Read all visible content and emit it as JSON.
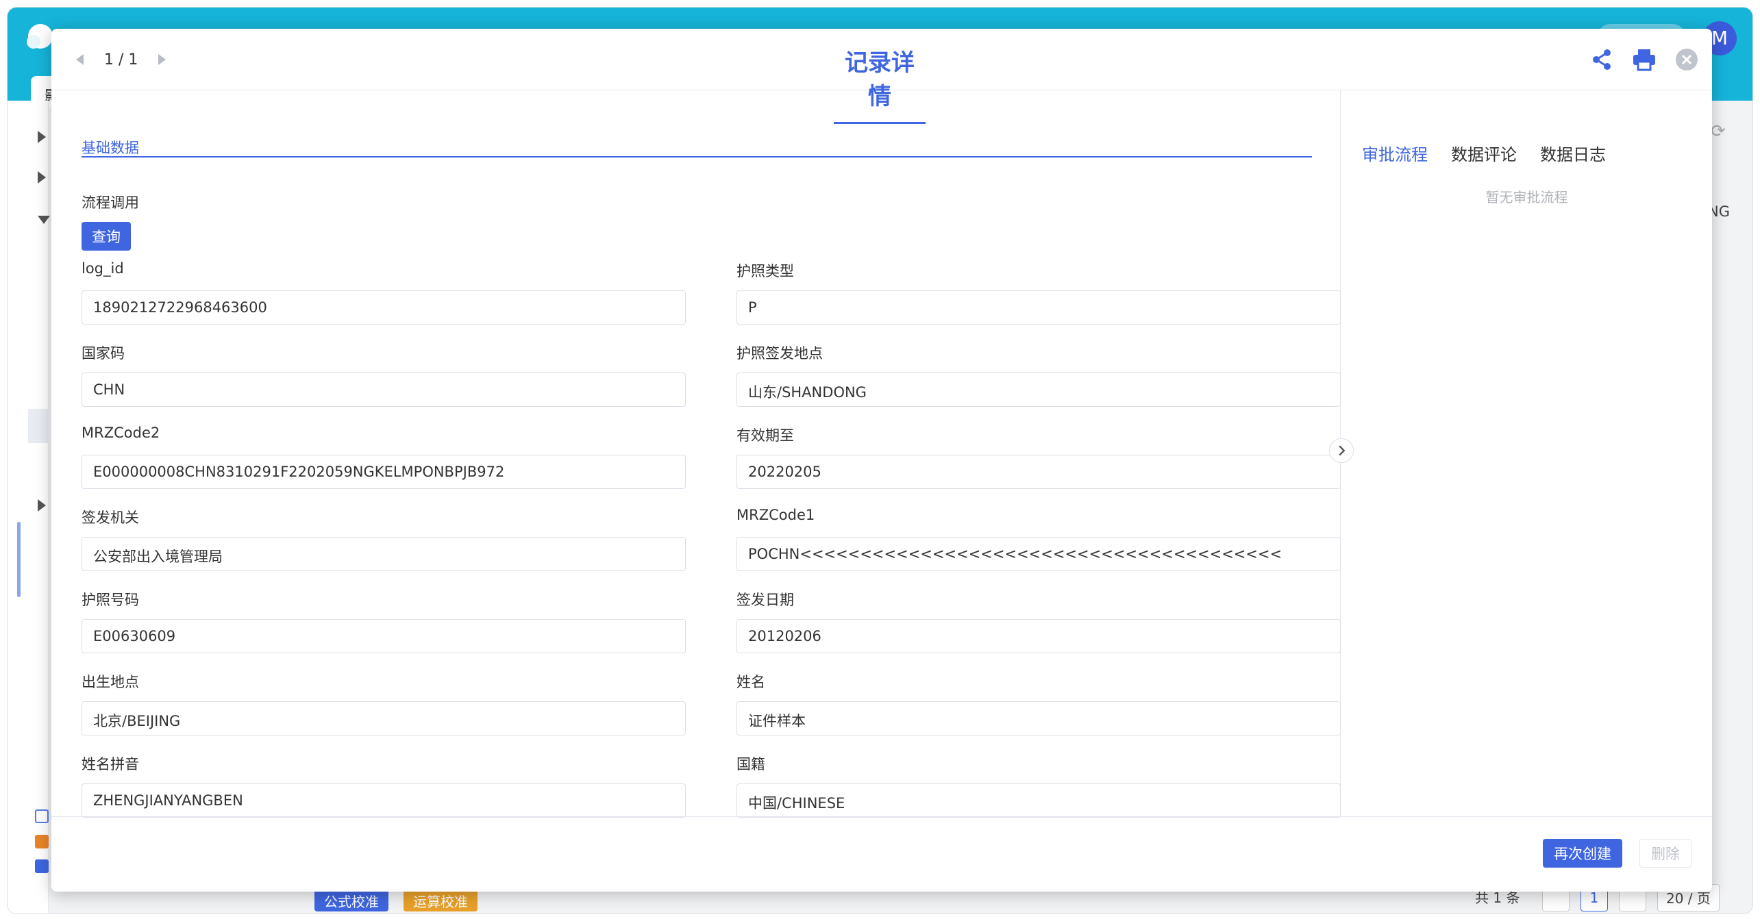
{
  "background": {
    "avatar_text": "M",
    "tab_text": "影",
    "table_fragment": "NG",
    "footer_buttons": [
      "公式校准",
      "运算校准"
    ],
    "pagination_text": "共 1 条",
    "current_page": "1",
    "page_size": "20 / 页"
  },
  "modal": {
    "pager": "1 / 1",
    "title": "记录详情",
    "section_tab": "基础数据",
    "flow_label": "流程调用",
    "query_button": "查询",
    "fields": [
      {
        "label": "log_id",
        "value": "1890212722968463600"
      },
      {
        "label": "护照类型",
        "value": "P"
      },
      {
        "label": "国家码",
        "value": "CHN"
      },
      {
        "label": "护照签发地点",
        "value": "山东/SHANDONG"
      },
      {
        "label": "MRZCode2",
        "value": "E000000008CHN8310291F2202059NGKELMPONBPJB972"
      },
      {
        "label": "有效期至",
        "value": "20220205"
      },
      {
        "label": "签发机关",
        "value": "公安部出入境管理局"
      },
      {
        "label": "MRZCode1",
        "value": "POCHN<<<<<<<<<<<<<<<<<<<<<<<<<<<<<<<<<<<<<<<<"
      },
      {
        "label": "护照号码",
        "value": "E00630609"
      },
      {
        "label": "签发日期",
        "value": "20120206"
      },
      {
        "label": "出生地点",
        "value": "北京/BEIJING"
      },
      {
        "label": "姓名",
        "value": "证件样本"
      },
      {
        "label": "姓名拼音",
        "value": "ZHENGJIANYANGBEN"
      },
      {
        "label": "国籍",
        "value": "中国/CHINESE"
      }
    ],
    "side_tabs": [
      "审批流程",
      "数据评论",
      "数据日志"
    ],
    "side_empty": "暂无审批流程",
    "footer": {
      "recreate": "再次创建",
      "delete": "删除"
    }
  },
  "colors": {
    "accent": "#3f66e0",
    "topbar": "#16b4d9"
  },
  "icons": [
    "share-icon",
    "print-icon",
    "close-icon",
    "chevron-right-icon",
    "caret-left-icon",
    "caret-right-icon"
  ]
}
